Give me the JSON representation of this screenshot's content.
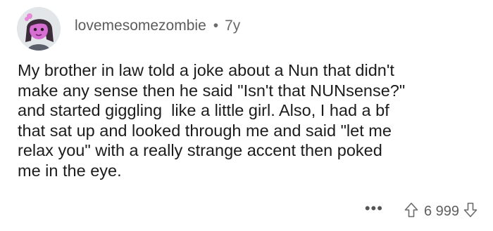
{
  "comment": {
    "username": "lovemesomezombie",
    "separator": "•",
    "age": "7y",
    "body": "My brother in law told a joke about a Nun that didn't\nmake any sense then he said \"Isn't that NUNsense?\"\nand started giggling  like a little girl. Also, I had a bf\nthat sat up and looked through me and said \"let me\nrelax you\" with a really strange accent then poked\nme in the eye.",
    "more_label": "•••",
    "votes": "6 999"
  },
  "icons": {
    "avatar": "avatar-icon",
    "upvote": "upvote-arrow-icon",
    "downvote": "downvote-arrow-icon",
    "more": "more-dots-icon"
  }
}
